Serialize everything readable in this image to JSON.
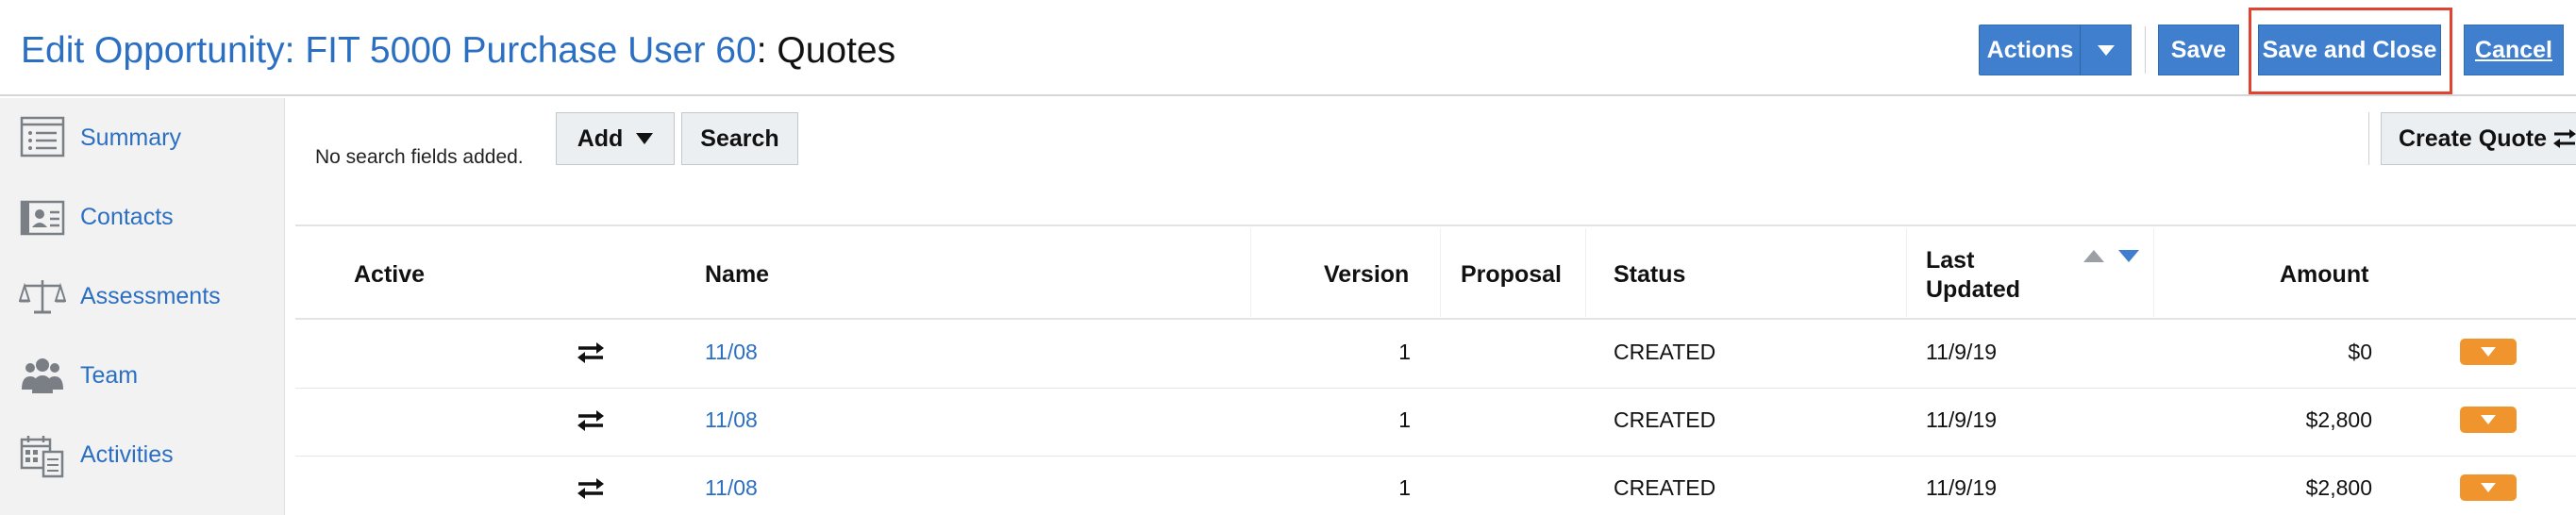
{
  "header": {
    "title_prefix": "Edit Opportunity: FIT 5000 Purchase User 60",
    "title_colon": ":",
    "title_section": "Quotes",
    "actions_label": "Actions",
    "save_label": "Save",
    "save_close_label": "Save and Close",
    "cancel_label": "Cancel"
  },
  "sidebar": {
    "items": [
      {
        "label": "Summary",
        "icon": "list-icon"
      },
      {
        "label": "Contacts",
        "icon": "contact-card-icon"
      },
      {
        "label": "Assessments",
        "icon": "scale-icon"
      },
      {
        "label": "Team",
        "icon": "team-icon"
      },
      {
        "label": "Activities",
        "icon": "calendar-icon"
      }
    ]
  },
  "search": {
    "no_fields_text": "No search fields added.",
    "add_label": "Add",
    "search_label": "Search",
    "create_quote_label": "Create Quote"
  },
  "table": {
    "columns": {
      "active": "Active",
      "name": "Name",
      "version": "Version",
      "proposal": "Proposal",
      "status": "Status",
      "last_updated_line1": "Last",
      "last_updated_line2": "Updated",
      "amount": "Amount"
    },
    "rows": [
      {
        "name": "11/08",
        "version": "1",
        "proposal": "",
        "status": "CREATED",
        "last_updated": "11/9/19",
        "amount": "$0"
      },
      {
        "name": "11/08",
        "version": "1",
        "proposal": "",
        "status": "CREATED",
        "last_updated": "11/9/19",
        "amount": "$2,800"
      },
      {
        "name": "11/08",
        "version": "1",
        "proposal": "",
        "status": "CREATED",
        "last_updated": "11/9/19",
        "amount": "$2,800"
      }
    ]
  },
  "colors": {
    "link_blue": "#2b6fc2",
    "button_blue": "#3f7fcd",
    "highlight_red": "#e0432f",
    "row_menu_orange": "#f0952d"
  }
}
